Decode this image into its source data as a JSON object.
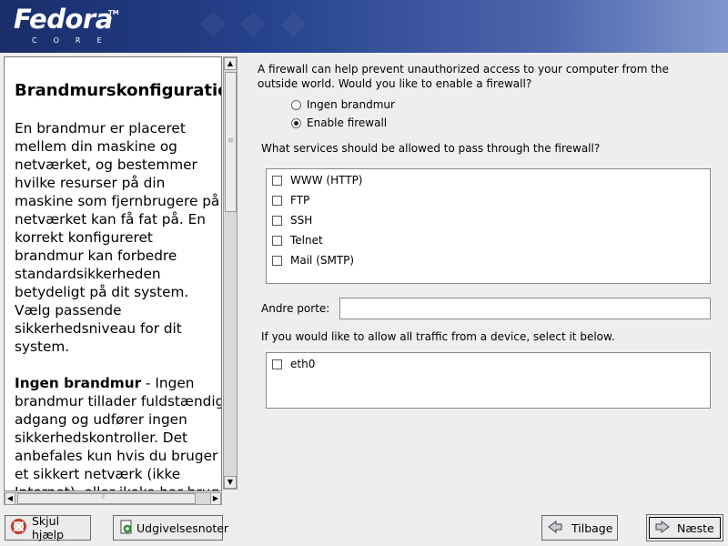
{
  "header": {
    "logo_text": "Fedora",
    "logo_sub": "CORE",
    "logo_tm": "TM"
  },
  "help": {
    "title": "Brandmurskonfiguration",
    "paragraphs": [
      "En brandmur er placeret mellem din maskine og netværket, og bestemmer hvilke resurser på din maskine som fjernbrugere på netværket kan få fat på. En korrekt konfigureret brandmur kan forbedre standardsikkerheden betydeligt på dit system.",
      "Vælg passende sikkerhedsniveau for dit system."
    ],
    "bold_lead": "Ingen brandmur",
    "bold_text": " - Ingen brandmur tillader fuldstændig adgang og udfører ingen sikkerhedskontroller. Det anbefales kun hvis du bruger et sikkert netværk (ikke Internet), eller ikoke har brug for"
  },
  "firewall": {
    "intro": "A firewall can help prevent unauthorized access to your computer from the outside world.  Would you like to enable a firewall?",
    "options": [
      {
        "label": "Ingen brandmur",
        "selected": false
      },
      {
        "label": "Enable firewall",
        "selected": true
      }
    ],
    "services_label": "What services should be allowed to pass through the firewall?",
    "services": [
      {
        "label": "WWW (HTTP)",
        "checked": false
      },
      {
        "label": "FTP",
        "checked": false
      },
      {
        "label": "SSH",
        "checked": false
      },
      {
        "label": "Telnet",
        "checked": false
      },
      {
        "label": "Mail (SMTP)",
        "checked": false
      }
    ],
    "other_ports_label": "Andre porte:",
    "other_ports_value": "",
    "devices_label": "If you would like to allow all traffic from a device, select it below.",
    "devices": [
      {
        "label": "eth0",
        "checked": false
      }
    ]
  },
  "buttons": {
    "hide_help": "Skjul hjælp",
    "release_notes": "Udgivelsesnoter",
    "back": "Tilbage",
    "next": "Næste"
  }
}
